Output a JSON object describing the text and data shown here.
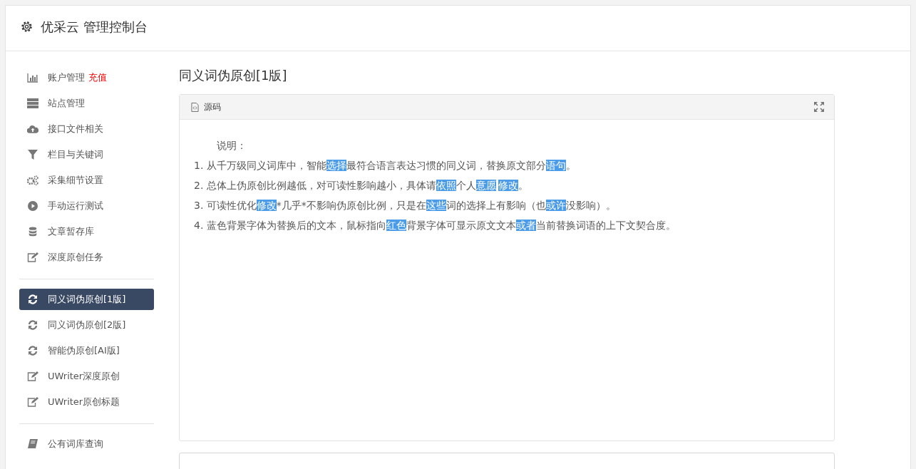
{
  "header": {
    "title": "优采云 管理控制台"
  },
  "sidebar": {
    "groups": [
      {
        "items": [
          {
            "kind": "chart",
            "label": "账户管理",
            "badge": "充值",
            "selected": false
          },
          {
            "kind": "server",
            "label": "站点管理",
            "selected": false
          },
          {
            "kind": "cloud",
            "label": "接口文件相关",
            "selected": false
          },
          {
            "kind": "filter",
            "label": "栏目与关键词",
            "selected": false
          },
          {
            "kind": "gears",
            "label": "采集细节设置",
            "selected": false
          },
          {
            "kind": "play",
            "label": "手动运行测试",
            "selected": false
          },
          {
            "kind": "database",
            "label": "文章暂存库",
            "selected": false
          },
          {
            "kind": "edit",
            "label": "深度原创任务",
            "selected": false
          }
        ]
      },
      {
        "items": [
          {
            "kind": "refresh",
            "label": "同义词伪原创[1版]",
            "selected": true
          },
          {
            "kind": "refresh",
            "label": "同义词伪原创[2版]",
            "selected": false
          },
          {
            "kind": "refresh",
            "label": "智能伪原创[AI版]",
            "selected": false
          },
          {
            "kind": "edit",
            "label": "UWriter深度原创",
            "selected": false
          },
          {
            "kind": "edit",
            "label": "UWriter原创标题",
            "selected": false
          }
        ]
      },
      {
        "items": [
          {
            "kind": "book",
            "label": "公有词库查询",
            "selected": false
          }
        ]
      }
    ]
  },
  "main": {
    "title": "同义词伪原创[1版]",
    "panel": {
      "title": "源码",
      "heading": "说明：",
      "lines": [
        [
          {
            "text": "1. 从千万级同义词库中，智能",
            "highlighted": false
          },
          {
            "text": "选择",
            "highlighted": true
          },
          {
            "text": "最符合语言表达习惯的同义词，替换原文部分",
            "highlighted": false
          },
          {
            "text": "语句",
            "highlighted": true
          },
          {
            "text": "。",
            "highlighted": false
          }
        ],
        [
          {
            "text": "2. 总体上伪原创比例越低，对可读性影响越小，具体请",
            "highlighted": false
          },
          {
            "text": "依照",
            "highlighted": true
          },
          {
            "text": "个人",
            "highlighted": false
          },
          {
            "text": "意愿",
            "highlighted": true
          },
          {
            "text": "修改",
            "highlighted": true
          },
          {
            "text": "。",
            "highlighted": false
          }
        ],
        [
          {
            "text": "3. 可读性优化",
            "highlighted": false
          },
          {
            "text": "修改",
            "highlighted": true
          },
          {
            "text": "*几乎*不影响伪原创比例，只是在",
            "highlighted": false
          },
          {
            "text": "这些",
            "highlighted": true
          },
          {
            "text": "词的选择上有影响（也",
            "highlighted": false
          },
          {
            "text": "或许",
            "highlighted": true
          },
          {
            "text": "没影响）。",
            "highlighted": false
          }
        ],
        [
          {
            "text": "4. 蓝色背景字体为替换后的文本，鼠标指向",
            "highlighted": false
          },
          {
            "text": "红色",
            "highlighted": true
          },
          {
            "text": "背景字体可显示原文文本",
            "highlighted": false
          },
          {
            "text": "或者",
            "highlighted": true
          },
          {
            "text": "当前替换词语的上下文契合度。",
            "highlighted": false
          }
        ]
      ]
    }
  }
}
